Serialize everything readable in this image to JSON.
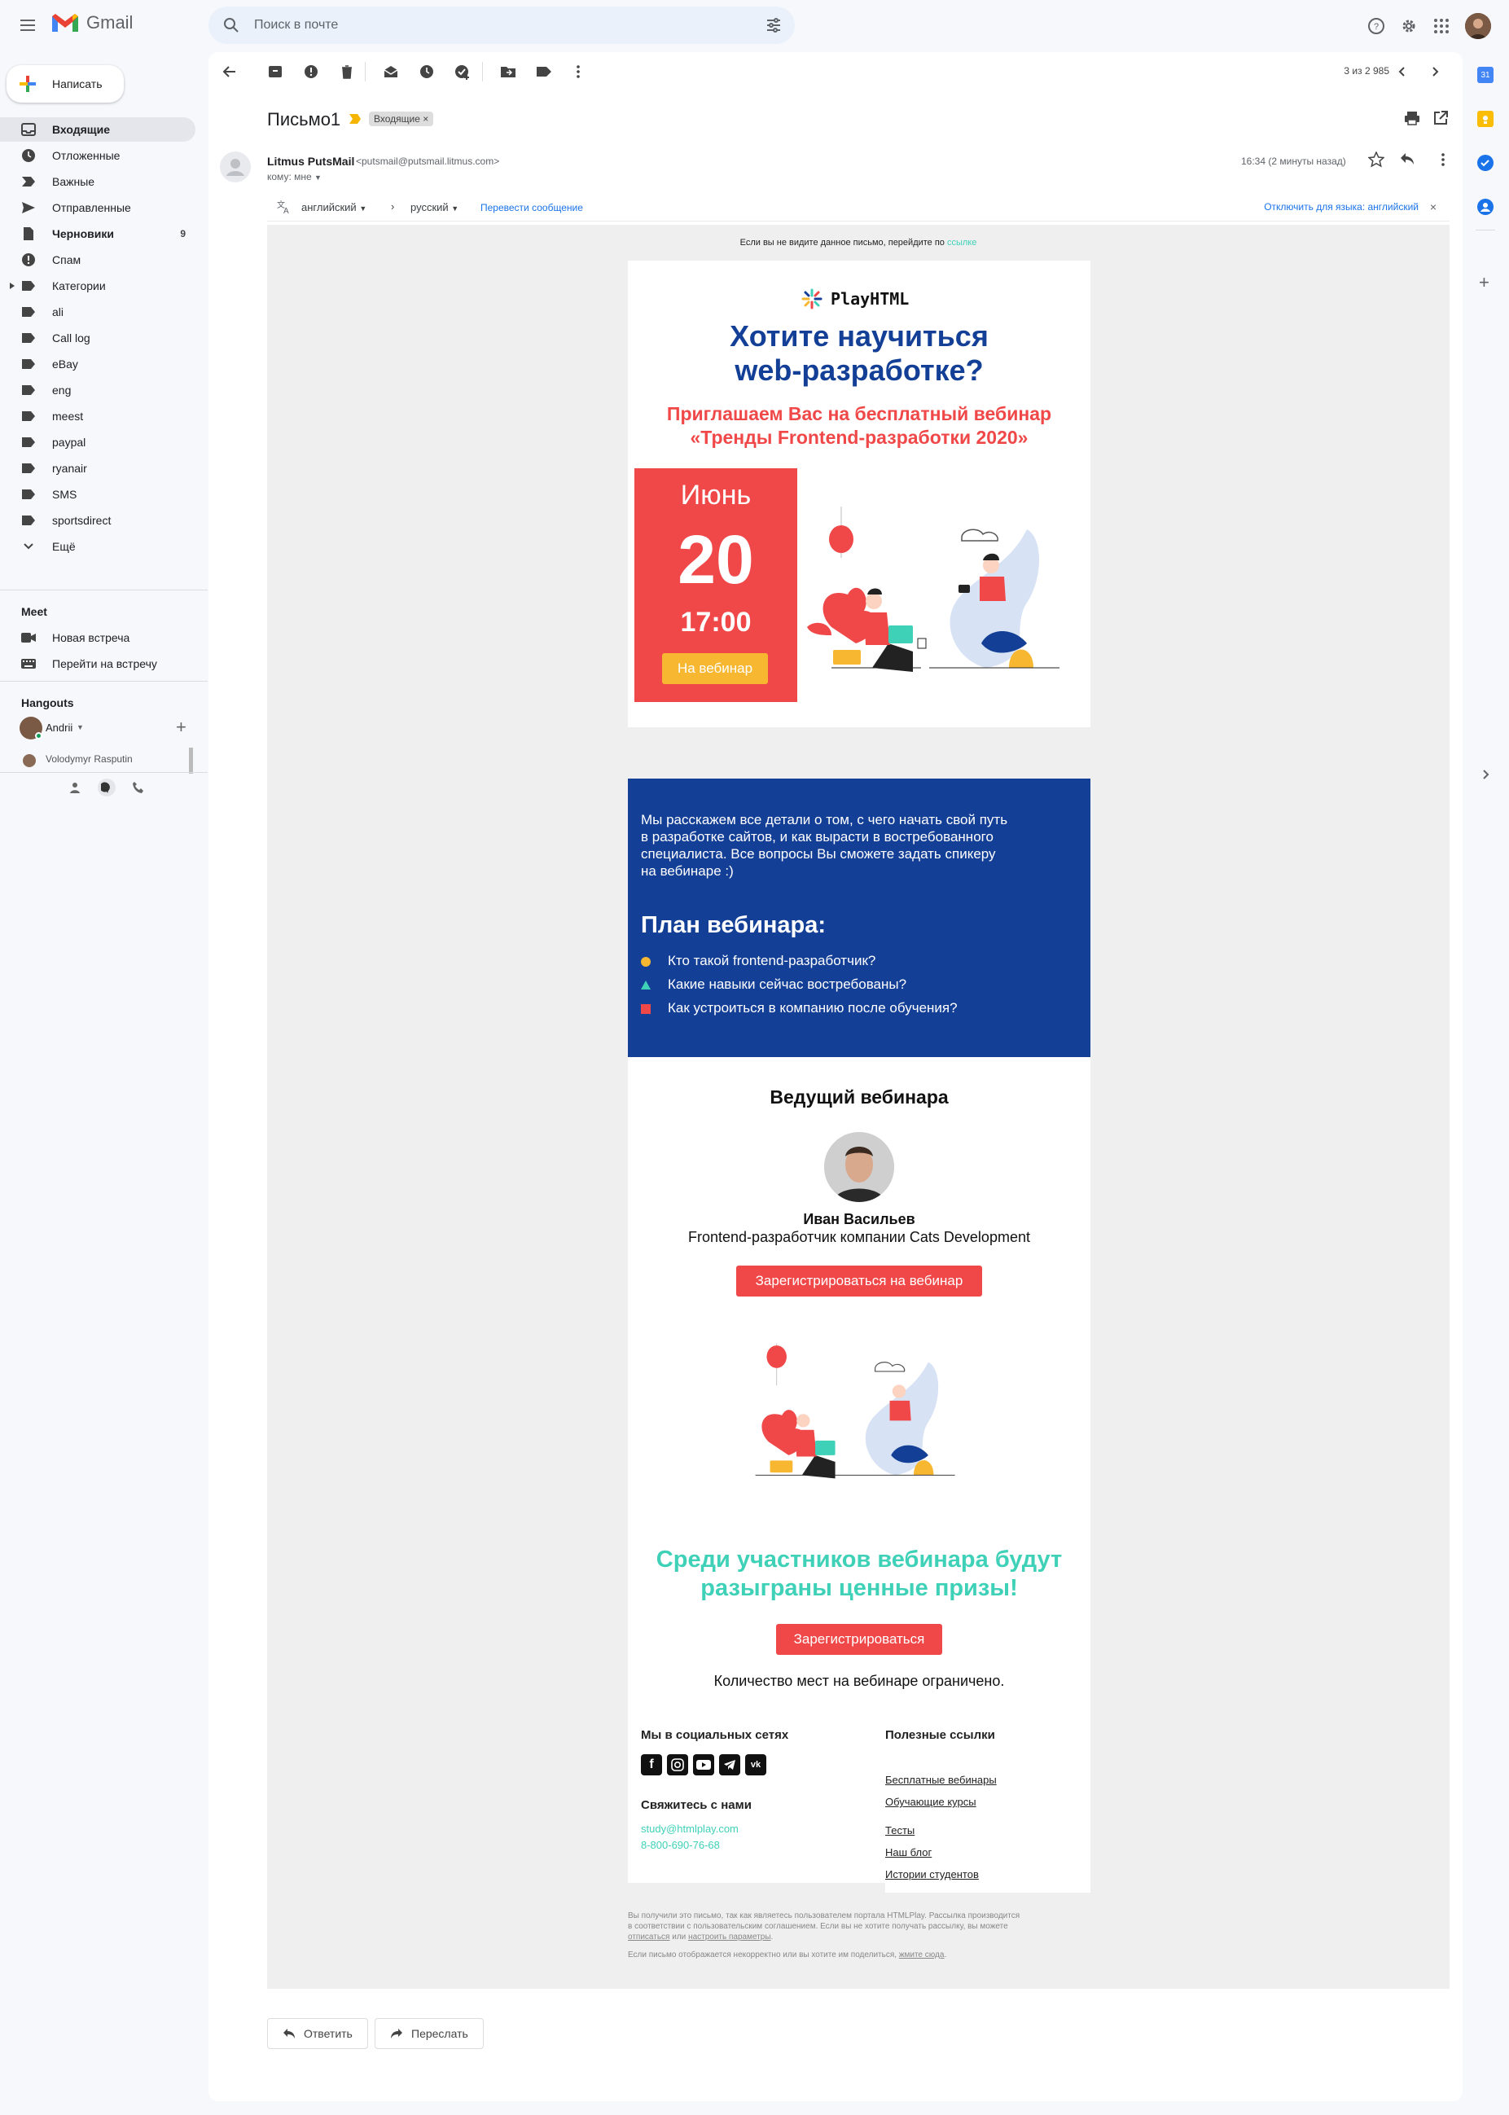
{
  "app": {
    "name": "Gmail"
  },
  "search": {
    "placeholder": "Поиск в почте"
  },
  "compose": {
    "label": "Написать"
  },
  "sidebar": {
    "items": [
      {
        "label": "Входящие",
        "count": ""
      },
      {
        "label": "Отложенные",
        "count": ""
      },
      {
        "label": "Важные",
        "count": ""
      },
      {
        "label": "Отправленные",
        "count": ""
      },
      {
        "label": "Черновики",
        "count": "9"
      },
      {
        "label": "Спам",
        "count": ""
      },
      {
        "label": "Категории",
        "count": ""
      },
      {
        "label": "ali",
        "count": ""
      },
      {
        "label": "Call log",
        "count": ""
      },
      {
        "label": "eBay",
        "count": ""
      },
      {
        "label": "eng",
        "count": ""
      },
      {
        "label": "meest",
        "count": ""
      },
      {
        "label": "paypal",
        "count": ""
      },
      {
        "label": "ryanair",
        "count": ""
      },
      {
        "label": "SMS",
        "count": ""
      },
      {
        "label": "sportsdirect",
        "count": ""
      },
      {
        "label": "Ещё",
        "count": ""
      }
    ],
    "meet": {
      "title": "Meet",
      "new_meeting": "Новая встреча",
      "join_meeting": "Перейти на встречу"
    },
    "hangouts": {
      "title": "Hangouts",
      "user": "Andrii",
      "contact": "Volodymyr Rasputin"
    }
  },
  "toolbar": {
    "pager": "3 из 2 985"
  },
  "message": {
    "subject": "Письмо1",
    "label": "Входящие",
    "sender_name": "Litmus PutsMail",
    "sender_email": "<putsmail@putsmail.litmus.com>",
    "to": "кому: мне",
    "time": "16:34 (2 минуты назад)"
  },
  "translate": {
    "from": "английский",
    "to": "русский",
    "action": "Перевести сообщение",
    "disable": "Отключить для языка: английский"
  },
  "email": {
    "preheader_text": "Если вы не видите данное письмо, перейдите по",
    "preheader_link": "ссылке",
    "brand": "PlayHTML",
    "headline_1": "Хотите научиться",
    "headline_2": "web-разработке?",
    "subheadline_1": "Приглашаем Вас на бесплатный вебинар",
    "subheadline_2": "«Тренды Frontend-разработки 2020»",
    "month": "Июнь",
    "day": "20",
    "time": "17:00",
    "date_button": "На вебинар",
    "intro_1": "Мы расскажем все детали о том, с чего начать свой путь",
    "intro_2": "в разработке сайтов, и как вырасти в востребованного",
    "intro_3": "специалиста. Все вопросы Вы сможете задать спикеру",
    "intro_4": "на вебинаре :)",
    "plan_title": "План вебинара:",
    "plan": [
      "Кто такой frontend-разработчик?",
      "Какие навыки сейчас востребованы?",
      "Как устроиться в компанию после обучения?"
    ],
    "host_title": "Ведущий вебинара",
    "host_name": "Иван Васильев",
    "host_role": "Frontend-разработчик компании Cats Development",
    "register_webinar": "Зарегистрироваться на вебинар",
    "prize_1": "Среди участников вебинара будут",
    "prize_2": "разыграны ценные призы!",
    "register": "Зарегистрироваться",
    "limited": "Количество мест на вебинаре ограничено.",
    "social_title": "Мы в социальных сетях",
    "contact_title": "Свяжитесь с нами",
    "contact_email": "study@htmlplay.com",
    "contact_phone": "8-800-690-76-68",
    "links_title": "Полезные ссылки",
    "links": [
      "Бесплатные вебинары",
      "Обучающие курсы",
      "Тесты",
      "Наш блог",
      "Истории студентов"
    ],
    "legal_1": "Вы получили это письмо, так как являетесь пользователем портала HTMLPlay. Рассылка производится",
    "legal_2": "в соответствии с пользовательским соглашением. Если вы не хотите получать рассылку, вы можете",
    "legal_unsub": "отписаться",
    "legal_or": "или",
    "legal_settings": "настроить параметры",
    "legal_3": "Если письмо отображается некорректно или вы хотите им поделиться,",
    "legal_share": "жмите сюда"
  },
  "actions": {
    "reply": "Ответить",
    "forward": "Переслать"
  },
  "colors": {
    "brand_blue": "#133f96",
    "brand_red": "#f04848",
    "accent_teal": "#3fd1b8",
    "accent_yellow": "#f7b731"
  }
}
